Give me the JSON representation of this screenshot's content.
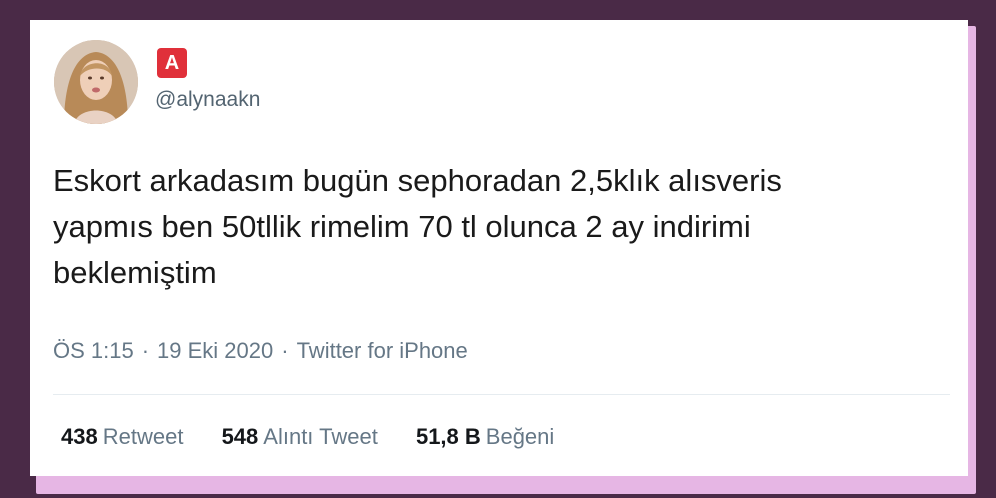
{
  "tweet": {
    "badge_letter": "A",
    "handle": "@alynaakn",
    "text": "Eskort arkadasım bugün sephoradan 2,5klık alısveris\nyapmıs ben 50tllik rimelim 70 tl olunca 2 ay indirimi\nbeklemiştim",
    "time": "ÖS 1:15",
    "date": "19 Eki 2020",
    "source": "Twitter for iPhone",
    "meta_separator": "·"
  },
  "stats": {
    "retweets": {
      "count": "438",
      "label": "Retweet"
    },
    "quotes": {
      "count": "548",
      "label": "Alıntı Tweet"
    },
    "likes": {
      "count": "51,8 B",
      "label": "Beğeni"
    }
  },
  "colors": {
    "background": "#4a2a47",
    "glow": "#e6b6e4",
    "card": "#ffffff",
    "badge": "#e0303a",
    "text": "#1a1a1a",
    "muted": "#657786"
  }
}
